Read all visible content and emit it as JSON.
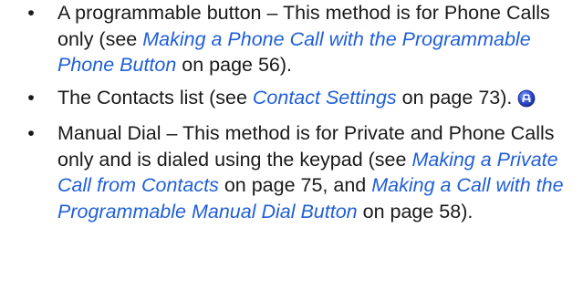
{
  "items": [
    {
      "bullet": "•",
      "t1": "A programmable button – This method is for Phone Calls only (see ",
      "link1": "Making a Phone Call with the Programmable Phone Button",
      "t2": " on page 56)."
    },
    {
      "bullet": "•",
      "t1": "The Contacts list (see ",
      "link1": "Contact Settings",
      "t2": " on page 73).",
      "icon": "contacts-feature-icon"
    },
    {
      "bullet": "•",
      "t1": "Manual Dial – This method is for Private and Phone Calls only and is dialed using the keypad (see ",
      "link1": "Making a Private Call from Contacts",
      "t2": " on page 75, and ",
      "link2": "Making a Call with the Programmable Manual Dial Button",
      "t3": " on page 58)."
    }
  ],
  "colors": {
    "text": "#1a1a1a",
    "link": "#1f5fd8",
    "icon_fill": "#2f4fd6"
  }
}
